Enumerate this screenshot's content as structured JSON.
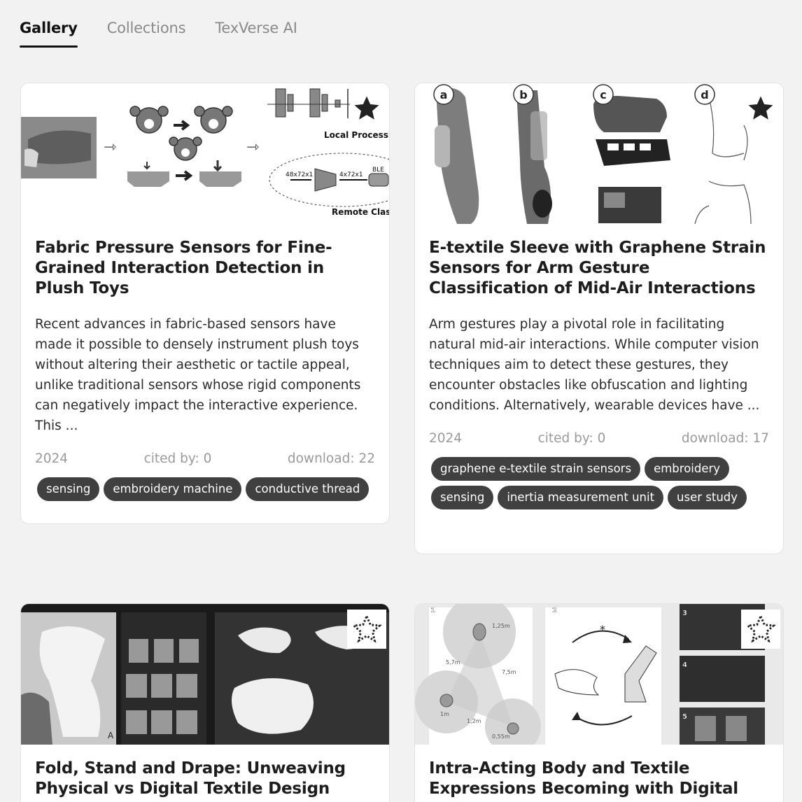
{
  "tabs": [
    {
      "label": "Gallery"
    },
    {
      "label": "Collections"
    },
    {
      "label": "TexVerse AI"
    }
  ],
  "cards": [
    {
      "thumb_labels": [
        "Local Processing",
        "Remote Classif",
        "48x72x1",
        "4x72x1",
        "BLE"
      ],
      "starred": true,
      "title": "Fabric Pressure Sensors for Fine-Grained Interaction Detection in Plush Toys",
      "abstract": "Recent advances in fabric-based sensors have made it possible to densely instrument plush toys without altering their aesthetic or tactile appeal, unlike traditional sensors whose rigid components can negatively impact the interactive experience. This ...",
      "year": "2024",
      "cited": "cited by: 0",
      "download": "download: 22",
      "tags": [
        "sensing",
        "embroidery machine",
        "conductive thread"
      ]
    },
    {
      "thumb_labels": [
        "a",
        "b",
        "c",
        "d"
      ],
      "starred": true,
      "title": "E-textile Sleeve with Graphene Strain Sensors for Arm Gesture Classification of Mid-Air Interactions",
      "abstract": "Arm gestures play a pivotal role in facilitating natural mid-air interactions. While computer vision techniques aim to detect these gestures, they encounter obstacles like obfuscation and lighting conditions. Alternatively, wearable devices have ...",
      "year": "2024",
      "cited": "cited by: 0",
      "download": "download: 17",
      "tags": [
        "graphene e-textile strain sensors",
        "embroidery",
        "sensing",
        "inertia measurement unit",
        "user study"
      ]
    },
    {
      "thumb_labels": [
        "A"
      ],
      "starred": false,
      "title": "Fold, Stand and Drape: Unweaving Physical vs Digital Textile Design"
    },
    {
      "thumb_labels": [
        "1",
        "2",
        "3",
        "4",
        "5",
        "1,25m",
        "5,7m",
        "7,5m",
        "1m",
        "1,2m",
        "0,55m",
        "*"
      ],
      "starred": false,
      "title": "Intra-Acting Body and Textile Expressions Becoming with Digital"
    }
  ],
  "icons": {
    "star_filled": "star-filled-icon",
    "star_outline": "star-outline-icon"
  },
  "colors": {
    "tag_bg": "#404040",
    "page_bg": "#f2f2f2",
    "active_tab": "#111111"
  }
}
